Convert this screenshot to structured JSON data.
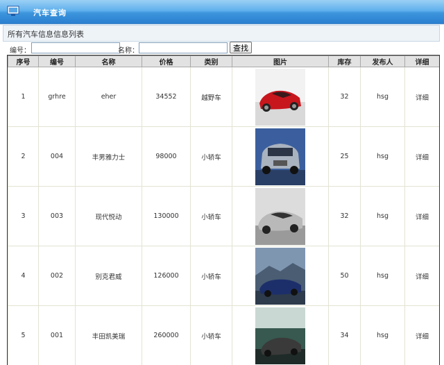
{
  "header": {
    "title": "汽车查询"
  },
  "subheader": {
    "text": "所有汽车信息信息列表"
  },
  "search": {
    "number_label": "编号：",
    "name_label": "名称：",
    "number_value": "",
    "name_value": "",
    "button_label": "查找"
  },
  "table": {
    "headers": [
      "序号",
      "编号",
      "名称",
      "价格",
      "类别",
      "图片",
      "库存",
      "发布人",
      "详细"
    ],
    "rows": [
      {
        "index": "1",
        "code": "grhre",
        "name": "eher",
        "price": "34552",
        "category": "越野车",
        "stock": "32",
        "publisher": "hsg",
        "detail": "详细"
      },
      {
        "index": "2",
        "code": "004",
        "name": "丰男雅力士",
        "price": "98000",
        "category": "小轿车",
        "stock": "25",
        "publisher": "hsg",
        "detail": "详细"
      },
      {
        "index": "3",
        "code": "003",
        "name": "现代悦动",
        "price": "130000",
        "category": "小轿车",
        "stock": "32",
        "publisher": "hsg",
        "detail": "详细"
      },
      {
        "index": "4",
        "code": "002",
        "name": "别克君威",
        "price": "126000",
        "category": "小轿车",
        "stock": "50",
        "publisher": "hsg",
        "detail": "详细"
      },
      {
        "index": "5",
        "code": "001",
        "name": "丰田凯美瑞",
        "price": "260000",
        "category": "小轿车",
        "stock": "34",
        "publisher": "hsg",
        "detail": "详细"
      }
    ]
  },
  "car_images": [
    {
      "icon": "red-sports-car-photo",
      "bg": "#f2f2f2",
      "car": "#c8161d"
    },
    {
      "icon": "blue-suv-photo",
      "bg": "#3b5f9e",
      "car": "#a9b2bf"
    },
    {
      "icon": "silver-coupe-photo",
      "bg": "#dcdcdc",
      "car": "#b9b9b9"
    },
    {
      "icon": "blue-convertible-photo",
      "bg": "#7f96b0",
      "car": "#1d2f6a"
    },
    {
      "icon": "dark-sedan-photo",
      "bg": "#37594f",
      "car": "#3a3a3a"
    }
  ]
}
